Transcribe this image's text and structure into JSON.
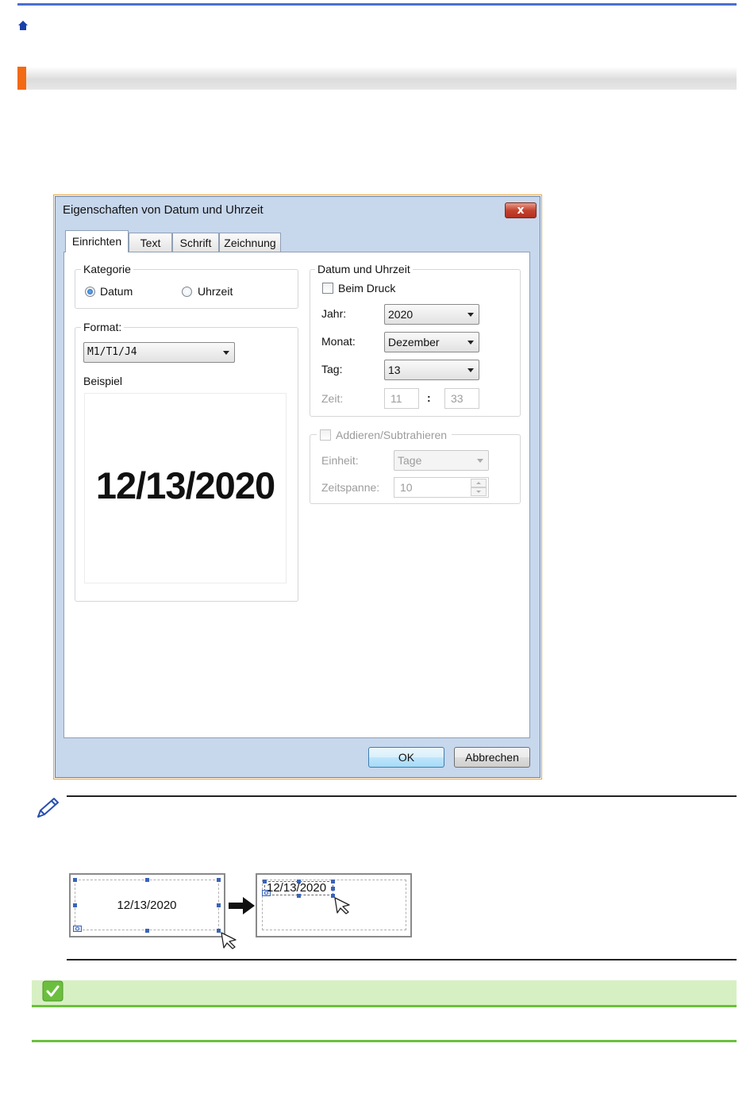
{
  "dialog": {
    "title": "Eigenschaften von Datum und Uhrzeit",
    "close_label": "x",
    "tabs": [
      {
        "label": "Einrichten"
      },
      {
        "label": "Text"
      },
      {
        "label": "Schrift"
      },
      {
        "label": "Zeichnung"
      }
    ],
    "kategorie": {
      "legend": "Kategorie",
      "options": [
        {
          "label": "Datum",
          "selected": true
        },
        {
          "label": "Uhrzeit",
          "selected": false
        }
      ]
    },
    "format": {
      "legend": "Format:",
      "value": "M1/T1/J4",
      "preview_label": "Beispiel",
      "preview_value": "12/13/2020"
    },
    "datum_uhrzeit": {
      "legend": "Datum und Uhrzeit",
      "beim_druck_label": "Beim Druck",
      "jahr_label": "Jahr:",
      "jahr_value": "2020",
      "monat_label": "Monat:",
      "monat_value": "Dezember",
      "tag_label": "Tag:",
      "tag_value": "13",
      "zeit_label": "Zeit:",
      "zeit_hour": "11",
      "zeit_sep": ":",
      "zeit_min": "33"
    },
    "addieren": {
      "legend": "Addieren/Subtrahieren",
      "einheit_label": "Einheit:",
      "einheit_value": "Tage",
      "zeitspanne_label": "Zeitspanne:",
      "zeitspanne_value": "10"
    },
    "ok_label": "OK",
    "cancel_label": "Abbrechen"
  },
  "example": {
    "before_text": "12/13/2020",
    "after_text": "12/13/2020"
  },
  "colors": {
    "top_rule": "#4a6fd0",
    "section_accent": "#f26a13",
    "related_green": "#6cbf3e"
  }
}
